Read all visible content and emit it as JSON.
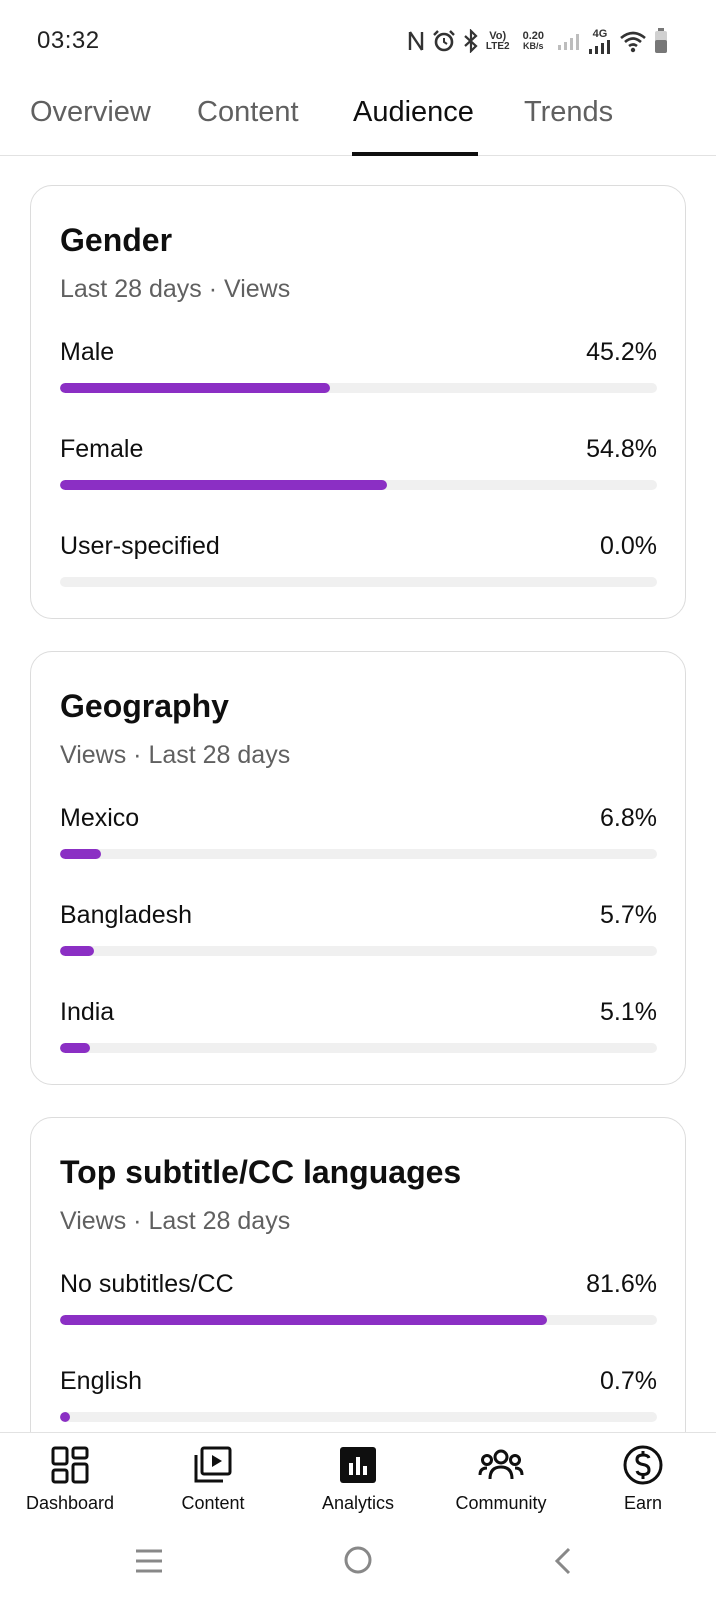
{
  "status_bar": {
    "time": "03:32",
    "volte_top": "Vo)",
    "volte_bottom": "LTE2",
    "speed_top": "0.20",
    "speed_bottom": "KB/s",
    "net_label": "4G",
    "icons": [
      "nfc-icon",
      "alarm-icon",
      "bluetooth-icon",
      "volte-icon",
      "signal-icon",
      "signal-4g-icon",
      "wifi-icon",
      "battery-icon"
    ]
  },
  "tabs": [
    {
      "label": "Overview",
      "active": false
    },
    {
      "label": "Content",
      "active": false
    },
    {
      "label": "Audience",
      "active": true
    },
    {
      "label": "Trends",
      "active": false
    }
  ],
  "accent_color": "#8b2fc4",
  "cards": {
    "gender": {
      "title": "Gender",
      "subtitle": "Last 28 days · Views",
      "rows": [
        {
          "label": "Male",
          "value": "45.2%",
          "fraction": 0.452
        },
        {
          "label": "Female",
          "value": "54.8%",
          "fraction": 0.548
        },
        {
          "label": "User-specified",
          "value": "0.0%",
          "fraction": 0.0
        }
      ]
    },
    "geography": {
      "title": "Geography",
      "subtitle": "Views · Last 28 days",
      "rows": [
        {
          "label": "Mexico",
          "value": "6.8%",
          "fraction": 0.068
        },
        {
          "label": "Bangladesh",
          "value": "5.7%",
          "fraction": 0.057
        },
        {
          "label": "India",
          "value": "5.1%",
          "fraction": 0.051
        }
      ]
    },
    "subtitles": {
      "title": "Top subtitle/CC languages",
      "subtitle": "Views · Last 28 days",
      "rows": [
        {
          "label": "No subtitles/CC",
          "value": "81.6%",
          "fraction": 0.816
        },
        {
          "label": "English",
          "value": "0.7%",
          "fraction": 0.007
        }
      ]
    }
  },
  "bottom_nav": [
    {
      "label": "Dashboard",
      "icon": "dashboard-icon"
    },
    {
      "label": "Content",
      "icon": "content-icon"
    },
    {
      "label": "Analytics",
      "icon": "analytics-icon",
      "active": true
    },
    {
      "label": "Community",
      "icon": "community-icon"
    },
    {
      "label": "Earn",
      "icon": "earn-icon"
    }
  ],
  "system_nav": [
    "recents-icon",
    "home-icon",
    "back-icon"
  ]
}
